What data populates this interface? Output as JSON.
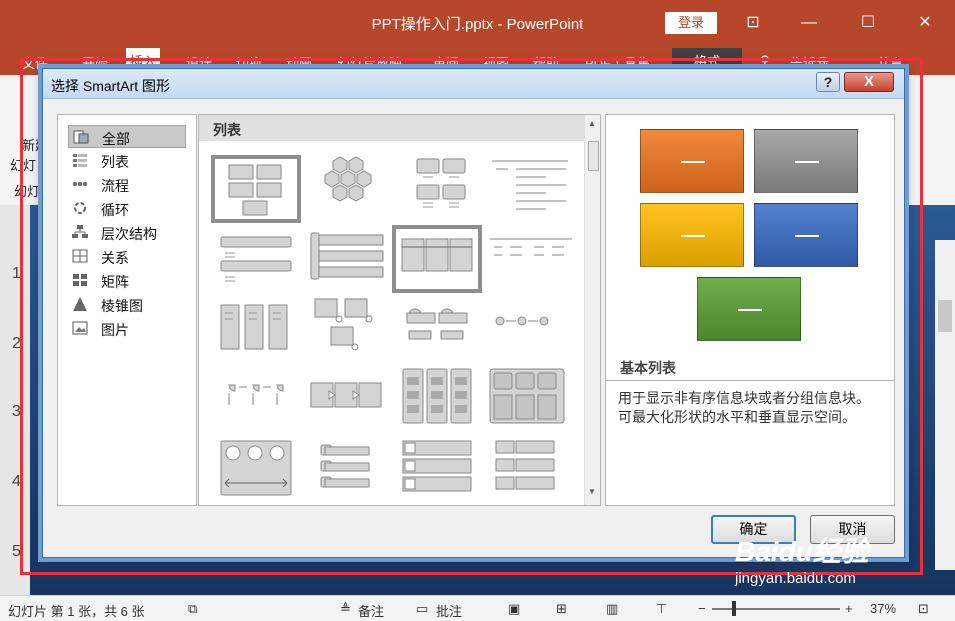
{
  "app": {
    "window_title": "PPT操作入门.pptx - PowerPoint",
    "login_label": "登录",
    "ribbon_tabs": [
      "文件",
      "开始",
      "插入",
      "设计",
      "切换",
      "动画",
      "幻灯片放映",
      "审阅",
      "视图",
      "帮助",
      "PDF工具集",
      "格式",
      "告诉我",
      "共享"
    ],
    "left_labels": [
      "新建",
      "幻灯",
      "幻灯"
    ],
    "slide_numbers": [
      "1",
      "2",
      "3",
      "4",
      "5"
    ]
  },
  "dialog": {
    "title": "选择 SmartArt 图形",
    "help_label": "?",
    "close_label": "X",
    "categories": [
      {
        "label": "全部",
        "icon": "all-icon",
        "selected": true
      },
      {
        "label": "列表",
        "icon": "list-icon"
      },
      {
        "label": "流程",
        "icon": "process-icon"
      },
      {
        "label": "循环",
        "icon": "cycle-icon"
      },
      {
        "label": "层次结构",
        "icon": "hierarchy-icon"
      },
      {
        "label": "关系",
        "icon": "relationship-icon"
      },
      {
        "label": "矩阵",
        "icon": "matrix-icon"
      },
      {
        "label": "棱锥图",
        "icon": "pyramid-icon"
      },
      {
        "label": "图片",
        "icon": "picture-icon"
      }
    ],
    "gallery_header": "列表",
    "preview": {
      "name": "基本列表",
      "description_lines": [
        "用于显示非有序信息块或者分组信息块。",
        "可最大化形状的水平和垂直显示空间。"
      ],
      "colors": [
        "#e2752c",
        "#8f8f8f",
        "#f2b200",
        "#3f6fbf",
        "#5c9a3a"
      ]
    },
    "ok_label": "确定",
    "cancel_label": "取消"
  },
  "statusbar": {
    "slide_info": "幻灯片 第 1 张，共 6 张",
    "notes_label": "备注",
    "comments_label": "批注",
    "zoom": "37%"
  },
  "watermark": {
    "brand": "Baidu经验",
    "url": "jingyan.baidu.com"
  }
}
